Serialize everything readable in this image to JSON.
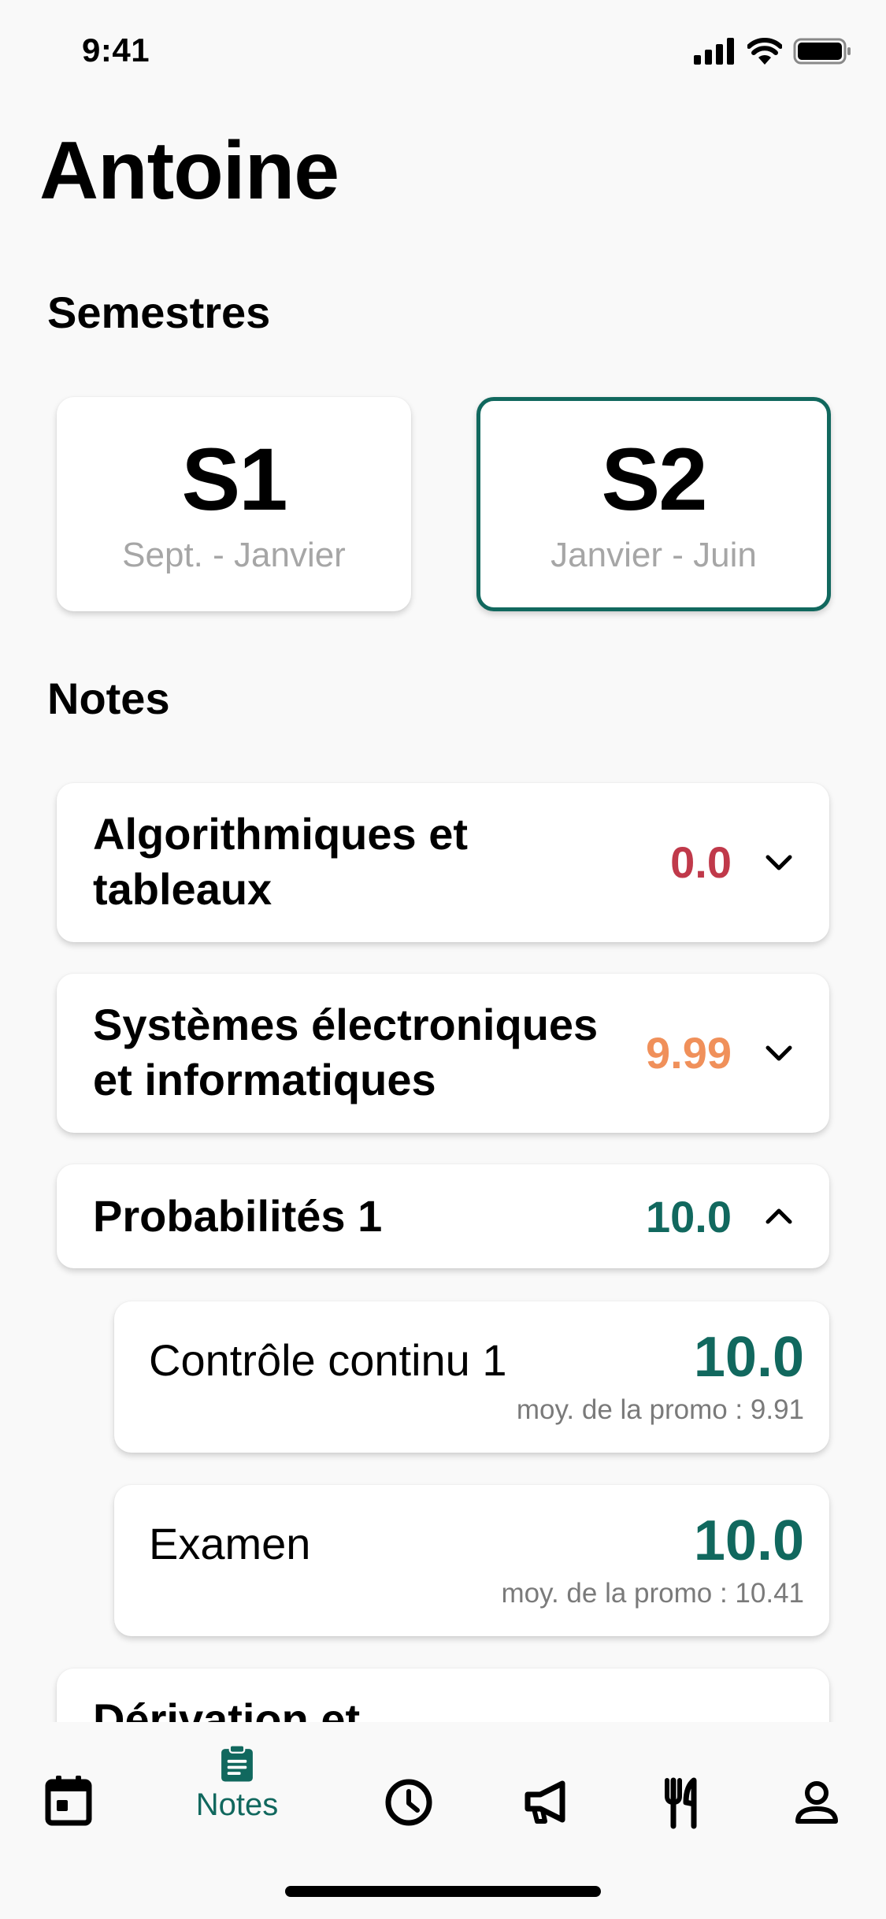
{
  "status_bar": {
    "time": "9:41"
  },
  "header": {
    "title": "Antoine"
  },
  "semesters": {
    "section_title": "Semestres",
    "items": [
      {
        "code": "S1",
        "range": "Sept. - Janvier",
        "selected": false
      },
      {
        "code": "S2",
        "range": "Janvier - Juin",
        "selected": true
      }
    ]
  },
  "notes": {
    "section_title": "Notes",
    "courses": [
      {
        "name_line1": "Algorithmiques et",
        "name_line2": "tableaux",
        "grade": "0.0",
        "grade_color": "#c0394a",
        "expanded": false
      },
      {
        "name_line1": "Systèmes électroniques",
        "name_line2": "et informatiques",
        "grade": "9.99",
        "grade_color": "#f0905a",
        "expanded": false
      },
      {
        "name_line1": "Probabilités 1",
        "grade": "10.0",
        "grade_color": "#11685e",
        "expanded": true,
        "assessments": [
          {
            "name": "Contrôle continu 1",
            "grade": "10.0",
            "average": "moy. de la promo : 9.91"
          },
          {
            "name": "Examen",
            "grade": "10.0",
            "average": "moy. de la promo : 10.41"
          }
        ]
      },
      {
        "name_line1": "Dérivation et",
        "expanded": false
      }
    ]
  },
  "tab_bar": {
    "active_label": "Notes",
    "items": [
      "calendar-icon",
      "notes-icon",
      "clock-icon",
      "megaphone-icon",
      "restaurant-icon",
      "person-icon"
    ]
  },
  "colors": {
    "accent": "#11685e",
    "background": "#f9f9f9"
  }
}
